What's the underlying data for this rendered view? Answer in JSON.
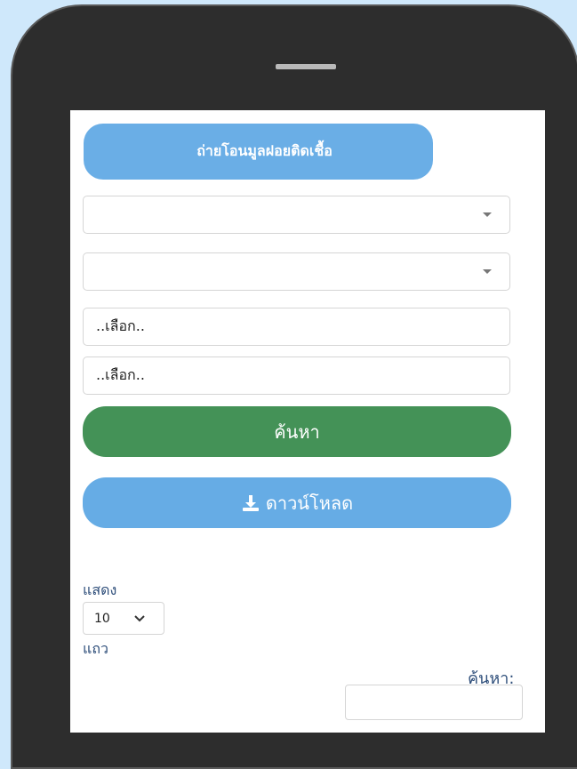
{
  "header": {
    "title": "ถ่ายโอนมูลฝอยติดเชื้อ"
  },
  "filters": {
    "select_1_value": "",
    "select_2_value": "",
    "date_from_placeholder": "..เลือก..",
    "date_to_placeholder": "..เลือก.."
  },
  "actions": {
    "search_label": "ค้นหา",
    "download_label": "ดาวน์โหลด"
  },
  "table_controls": {
    "show_label": "แสดง",
    "page_length": "10",
    "rows_label": "แถว",
    "search_label": "ค้นหา:"
  },
  "colors": {
    "primary_blue": "#6aaee6",
    "search_green": "#449257",
    "label_navy": "#2e4e7a"
  },
  "icons": {
    "download": "download-icon",
    "dropdown_caret": "caret-down-icon",
    "chevron": "chevron-down-icon"
  }
}
